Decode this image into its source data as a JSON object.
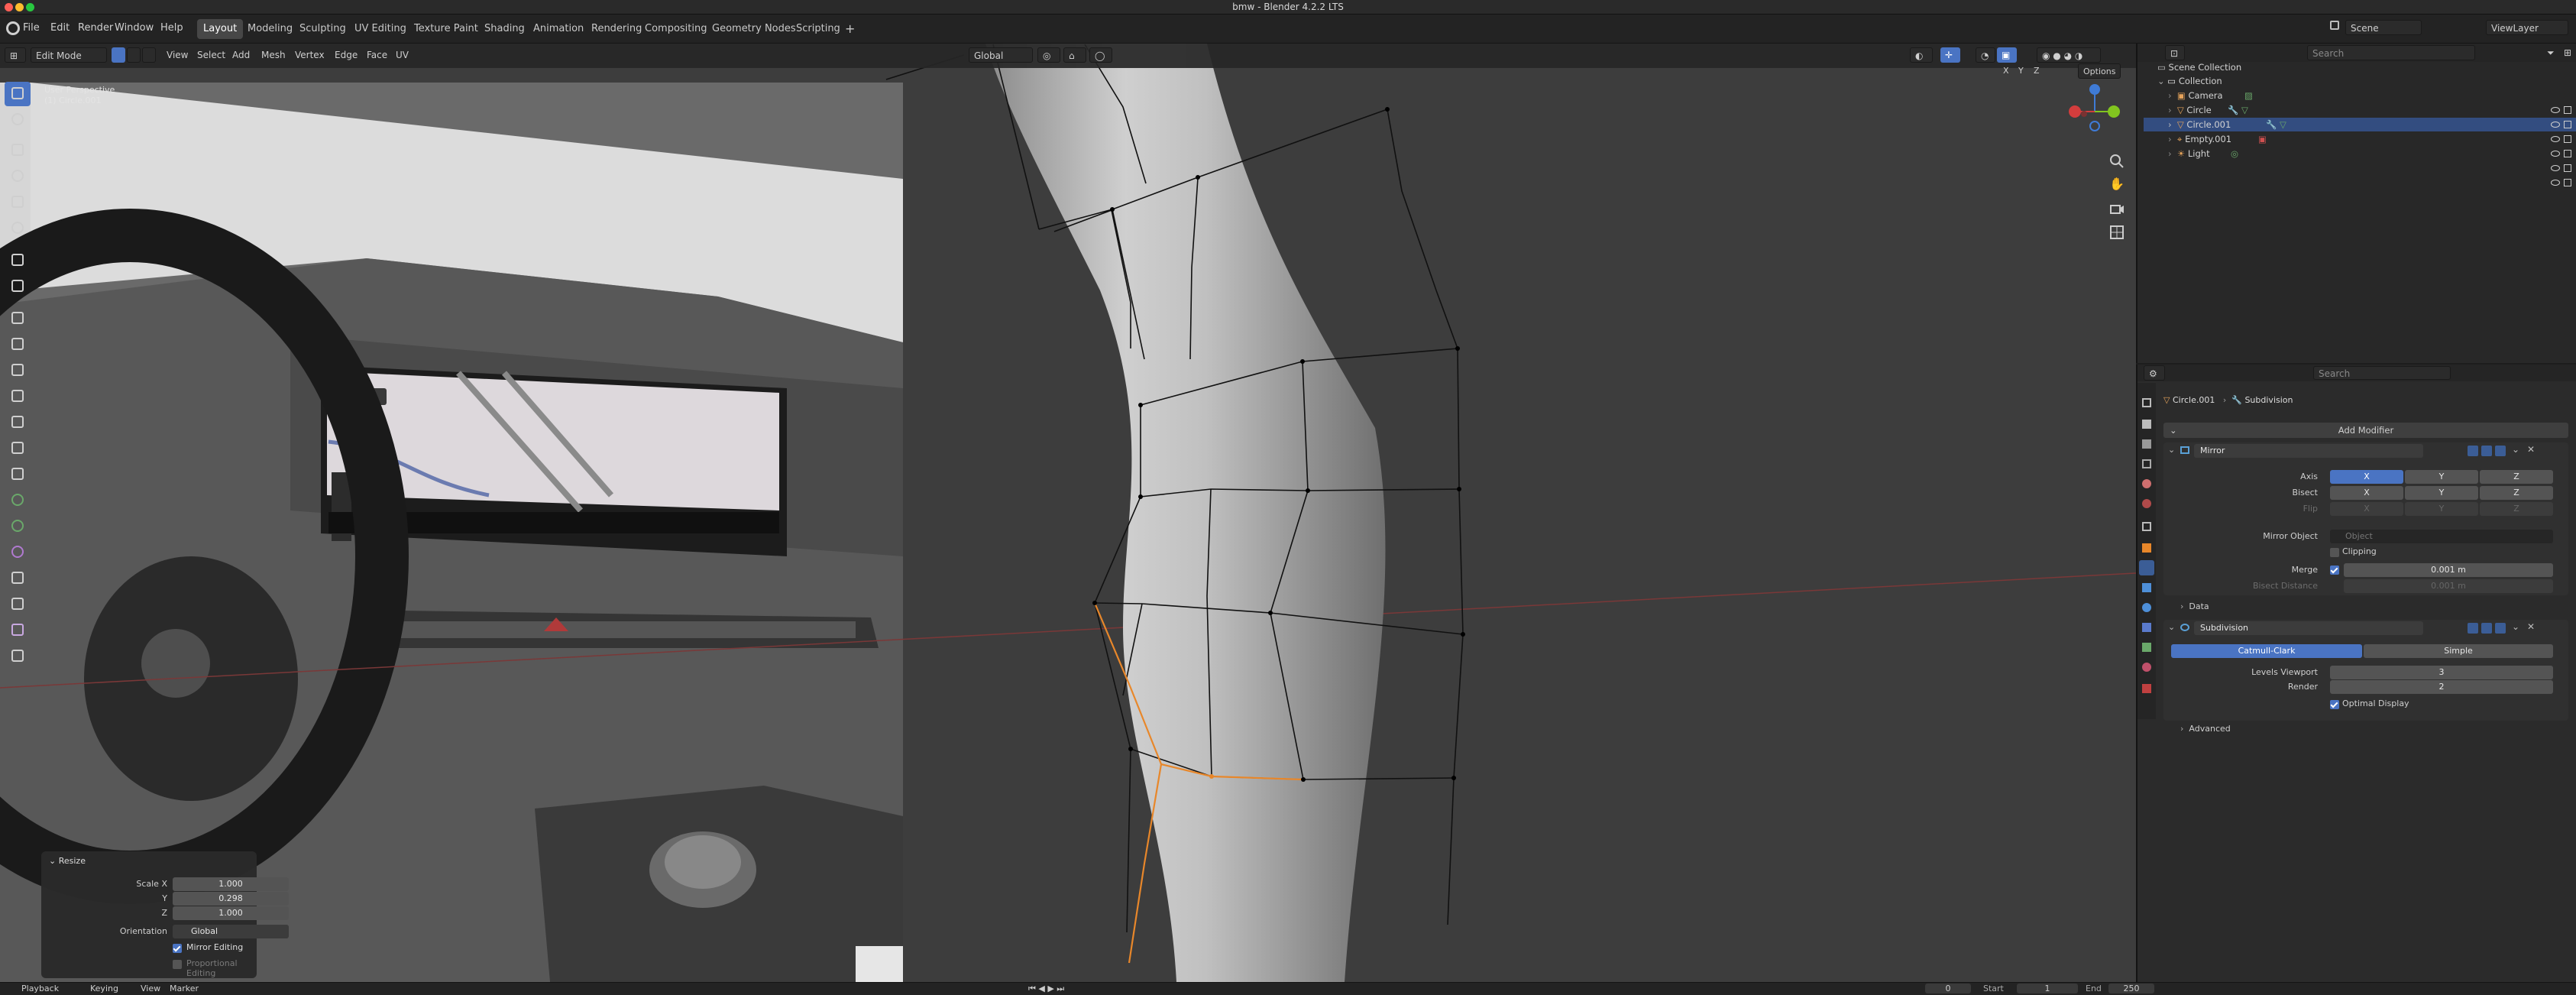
{
  "window": {
    "title": "bmw - Blender 4.2.2 LTS"
  },
  "menu": {
    "items": [
      "File",
      "Edit",
      "Render",
      "Window",
      "Help"
    ]
  },
  "workspaces": {
    "tabs": [
      "Layout",
      "Modeling",
      "Sculpting",
      "UV Editing",
      "Texture Paint",
      "Shading",
      "Animation",
      "Rendering",
      "Compositing",
      "Geometry Nodes",
      "Scripting"
    ],
    "active": "Layout"
  },
  "topright": {
    "scene": "Scene",
    "view_layer": "ViewLayer"
  },
  "viewport": {
    "mode": "Edit Mode",
    "menus": [
      "View",
      "Select",
      "Add",
      "Mesh",
      "Vertex",
      "Edge",
      "Face",
      "UV"
    ],
    "transform_orientation": "Global",
    "options_label": "Options",
    "overlay_title": "User Perspective",
    "overlay_object": "(1) Circle.001",
    "axes": [
      "X",
      "Y",
      "Z"
    ]
  },
  "resize_panel": {
    "title": "Resize",
    "scale_x_label": "Scale X",
    "scale_x": "1.000",
    "y_label": "Y",
    "scale_y": "0.298",
    "z_label": "Z",
    "scale_z": "1.000",
    "orientation_label": "Orientation",
    "orientation": "Global",
    "mirror_editing": "Mirror Editing",
    "proportional_editing": "Proportional Editing"
  },
  "outliner": {
    "search_placeholder": "Search",
    "scene_collection": "Scene Collection",
    "collection": "Collection",
    "items": [
      "Camera",
      "Circle",
      "Circle.001",
      "Empty.001",
      "Light"
    ],
    "selected": "Circle.001"
  },
  "properties": {
    "search_placeholder": "Search",
    "breadcrumb_object": "Circle.001",
    "breadcrumb_modifier": "Subdivision",
    "add_modifier": "Add Modifier",
    "mirror": {
      "name": "Mirror",
      "axis_label": "Axis",
      "bisect_label": "Bisect",
      "flip_label": "Flip",
      "axes": [
        "X",
        "Y",
        "Z"
      ],
      "mirror_object_label": "Mirror Object",
      "mirror_object_placeholder": "Object",
      "clipping": "Clipping",
      "merge_label": "Merge",
      "merge_value": "0.001 m",
      "bisect_distance_label": "Bisect Distance",
      "bisect_distance_value": "0.001 m",
      "data": "Data"
    },
    "subdivision": {
      "name": "Subdivision",
      "catmull": "Catmull-Clark",
      "simple": "Simple",
      "levels_viewport_label": "Levels Viewport",
      "levels_viewport": "3",
      "render_label": "Render",
      "render": "2",
      "optimal_display": "Optimal Display",
      "advanced": "Advanced"
    }
  },
  "statusbar": {
    "items": [
      "Playback",
      "Keying",
      "View",
      "Marker"
    ],
    "start_label": "Start",
    "start": "1",
    "end_label": "End",
    "end": "250",
    "frame": "0"
  },
  "colors": {
    "accent": "#4a74c3",
    "selection_orange": "#e8872a",
    "header": "#232323",
    "viewport_bg": "#3d3d3d"
  }
}
